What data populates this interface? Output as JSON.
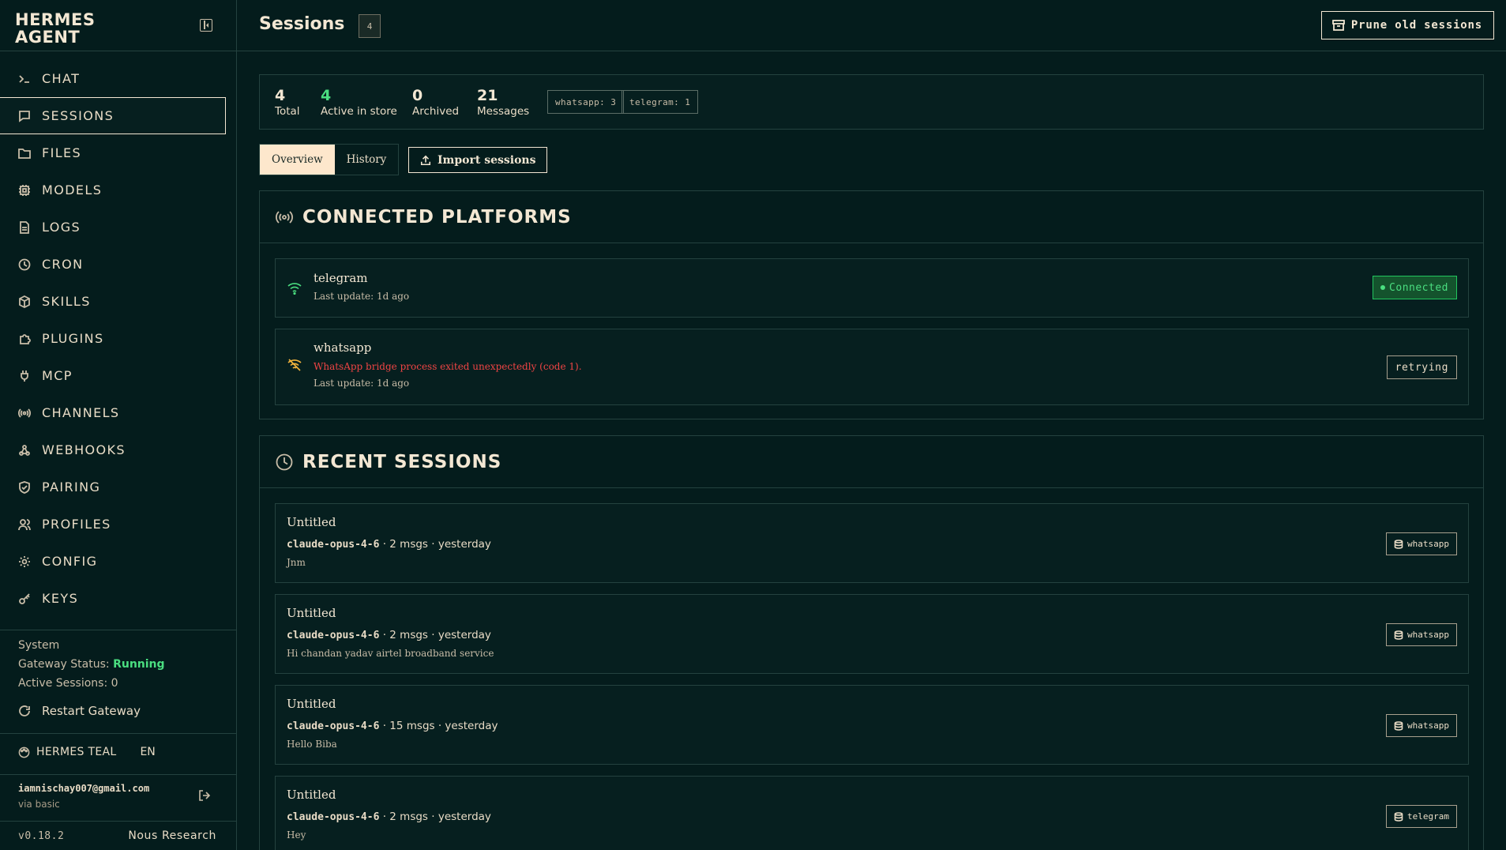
{
  "brand": {
    "line1": "HERMES",
    "line2": "AGENT"
  },
  "sidebar": {
    "items": [
      {
        "label": "CHAT",
        "icon": "terminal-icon"
      },
      {
        "label": "SESSIONS",
        "icon": "message-square-icon",
        "active": true
      },
      {
        "label": "FILES",
        "icon": "folder-icon"
      },
      {
        "label": "MODELS",
        "icon": "cpu-icon"
      },
      {
        "label": "LOGS",
        "icon": "file-text-icon"
      },
      {
        "label": "CRON",
        "icon": "clock-icon"
      },
      {
        "label": "SKILLS",
        "icon": "package-icon"
      },
      {
        "label": "PLUGINS",
        "icon": "puzzle-icon"
      },
      {
        "label": "MCP",
        "icon": "plug-icon"
      },
      {
        "label": "CHANNELS",
        "icon": "radio-icon"
      },
      {
        "label": "WEBHOOKS",
        "icon": "webhook-icon"
      },
      {
        "label": "PAIRING",
        "icon": "shield-check-icon"
      },
      {
        "label": "PROFILES",
        "icon": "users-icon"
      },
      {
        "label": "CONFIG",
        "icon": "settings-icon"
      },
      {
        "label": "KEYS",
        "icon": "key-icon"
      }
    ],
    "system": {
      "heading": "System",
      "gateway_label": "Gateway Status:",
      "gateway_value": "Running",
      "active_label": "Active Sessions:",
      "active_value": "0",
      "restart_label": "Restart Gateway"
    },
    "theme": {
      "name": "HERMES TEAL",
      "lang": "EN"
    },
    "user": {
      "email": "iamnischay007@gmail.com",
      "via": "via basic"
    },
    "version": "v0.18.2",
    "org": "Nous Research"
  },
  "header": {
    "title": "Sessions",
    "count": "4",
    "prune_label": "Prune old sessions"
  },
  "stats": {
    "total": {
      "value": "4",
      "label": "Total"
    },
    "active": {
      "value": "4",
      "label": "Active in store"
    },
    "archived": {
      "value": "0",
      "label": "Archived"
    },
    "messages": {
      "value": "21",
      "label": "Messages"
    },
    "platform_badges": [
      "whatsapp: 3",
      "telegram: 1"
    ]
  },
  "tabs": {
    "overview": "Overview",
    "history": "History",
    "import_label": "Import sessions"
  },
  "platforms": {
    "title": "CONNECTED PLATFORMS",
    "items": [
      {
        "name": "telegram",
        "error": "",
        "updated": "Last update: 1d ago",
        "status": "Connected"
      },
      {
        "name": "whatsapp",
        "error": "WhatsApp bridge process exited unexpectedly (code 1).",
        "updated": "Last update: 1d ago",
        "status": "retrying"
      }
    ]
  },
  "recent": {
    "title": "RECENT SESSIONS",
    "items": [
      {
        "title": "Untitled",
        "model": "claude-opus-4-6",
        "meta": "· 2 msgs · yesterday",
        "preview": "Jnm",
        "platform": "whatsapp"
      },
      {
        "title": "Untitled",
        "model": "claude-opus-4-6",
        "meta": "· 2 msgs · yesterday",
        "preview": "Hi chandan yadav airtel broadband service",
        "platform": "whatsapp"
      },
      {
        "title": "Untitled",
        "model": "claude-opus-4-6",
        "meta": "· 15 msgs · yesterday",
        "preview": "Hello Biba",
        "platform": "whatsapp"
      },
      {
        "title": "Untitled",
        "model": "claude-opus-4-6",
        "meta": "· 2 msgs · yesterday",
        "preview": "Hey",
        "platform": "telegram"
      }
    ]
  },
  "colors": {
    "background": "#041c1c",
    "text": "#f3e7d3",
    "accent_green": "#4ade80",
    "error_red": "#ef4444",
    "tab_active": "#fde7cc"
  }
}
